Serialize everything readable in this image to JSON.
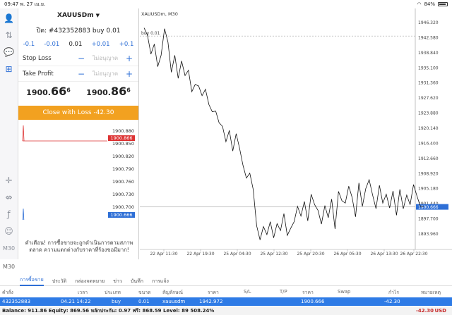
{
  "status": {
    "time": "09:47",
    "date": "พ. 27 เม.ย.",
    "battery": "84%"
  },
  "toolbar": {
    "icons": [
      "user-icon",
      "swap-icon",
      "chat-icon",
      "add-order-icon"
    ],
    "bottom_icons": [
      "crosshair-icon",
      "move-icon",
      "function-icon",
      "people-icon"
    ],
    "timeframe": "M30"
  },
  "panel": {
    "symbol": "XAUUSDm",
    "order_title": "ปิด: #432352883 buy 0.01",
    "steps": [
      "-0.1",
      "-0.01",
      "0.01",
      "+0.01",
      "+0.1"
    ],
    "stop_loss": {
      "label": "Stop Loss",
      "value": "ไม่อนุญาต"
    },
    "take_profit": {
      "label": "Take Profit",
      "value": "ไม่อนุญาต"
    },
    "bid": {
      "prefix": "1900.",
      "big": "66",
      "sup": "6"
    },
    "ask": {
      "prefix": "1900.",
      "big": "86",
      "sup": "6"
    },
    "close_button": "Close with Loss -42.30",
    "mini_scale": [
      "1900.880",
      "1900.866",
      "1900.850",
      "1900.820",
      "1900.790",
      "1900.760",
      "1900.730",
      "1900.700",
      "1900.666"
    ],
    "warning": "คำเตือน! การซื้อขายจะถูกดำเนินการตามสภาพตลาด ความแตกต่างกับราคาที่ร้องขอมีมาก!"
  },
  "chart": {
    "title": "XAUUSDm, M30",
    "order_line_label": "buy 0.01",
    "y_ticks": [
      "1946.320",
      "1942.580",
      "1938.840",
      "1935.100",
      "1931.360",
      "1927.620",
      "1923.880",
      "1920.140",
      "1916.400",
      "1912.660",
      "1908.920",
      "1905.180",
      "1901.440",
      "1897.700",
      "1893.960"
    ],
    "price_tag": "1900.666",
    "x_ticks": [
      "22 Apr 11:30",
      "22 Apr 19:30",
      "25 Apr 04:30",
      "25 Apr 12:30",
      "25 Apr 20:30",
      "26 Apr 05:30",
      "26 Apr 13:30",
      "26 Apr 22:30"
    ],
    "price_series": [
      1945.0,
      1943.2,
      1938.5,
      1941.0,
      1935.4,
      1938.2,
      1944.8,
      1941.5,
      1934.0,
      1938.2,
      1932.5,
      1936.8,
      1933.2,
      1934.5,
      1929.2,
      1931.0,
      1930.6,
      1928.2,
      1929.8,
      1926.0,
      1924.2,
      1924.4,
      1921.5,
      1920.6,
      1916.8,
      1919.6,
      1914.5,
      1918.8,
      1915.2,
      1911.0,
      1907.8,
      1909.0,
      1905.0,
      1896.0,
      1892.5,
      1895.8,
      1893.8,
      1897.0,
      1893.0,
      1896.5,
      1894.8,
      1899.0,
      1893.6,
      1895.4,
      1897.0,
      1900.8,
      1898.4,
      1902.0,
      1897.2,
      1903.8,
      1901.2,
      1899.8,
      1896.4,
      1901.0,
      1898.0,
      1902.6,
      1895.2,
      1904.5,
      1902.2,
      1901.6,
      1905.8,
      1903.0,
      1898.2,
      1906.6,
      1900.8,
      1905.2,
      1907.4,
      1903.6,
      1900.2,
      1906.0,
      1901.6,
      1903.8,
      1900.4,
      1904.6,
      1898.6,
      1905.0,
      1900.2,
      1903.6,
      1901.2,
      1906.2,
      1903.4,
      1900.8,
      1900.666
    ]
  },
  "tabs": {
    "side": "M30",
    "items": [
      "การซื้อขาย",
      "ประวัติ",
      "กล่องจดหมาย",
      "ข่าว",
      "บันทึก",
      "การแจ้ง"
    ]
  },
  "table": {
    "headers": [
      "คำสั่ง",
      "เวลา",
      "ประเภท",
      "ขนาด",
      "สัญลักษณ์",
      "ราคา",
      "S/L",
      "T/P",
      "ราคา",
      "Swap",
      "กำไร",
      "หมายเหตุ"
    ],
    "row": [
      "432352883",
      "04.21 14:22",
      "buy",
      "0.01",
      "xauusdm",
      "1942.972",
      "",
      "",
      "1900.666",
      "",
      "-42.30",
      ""
    ]
  },
  "balance": {
    "text": "Balance: 911.86 Equity: 869.56 หลักประกัน: 0.97 ฟรี: 868.59 Level: 89 508.24%",
    "pl": "-42.30",
    "currency": "USD"
  },
  "colors": {
    "accent": "#2e6fd6",
    "close": "#f2a120",
    "loss": "#c62828"
  }
}
